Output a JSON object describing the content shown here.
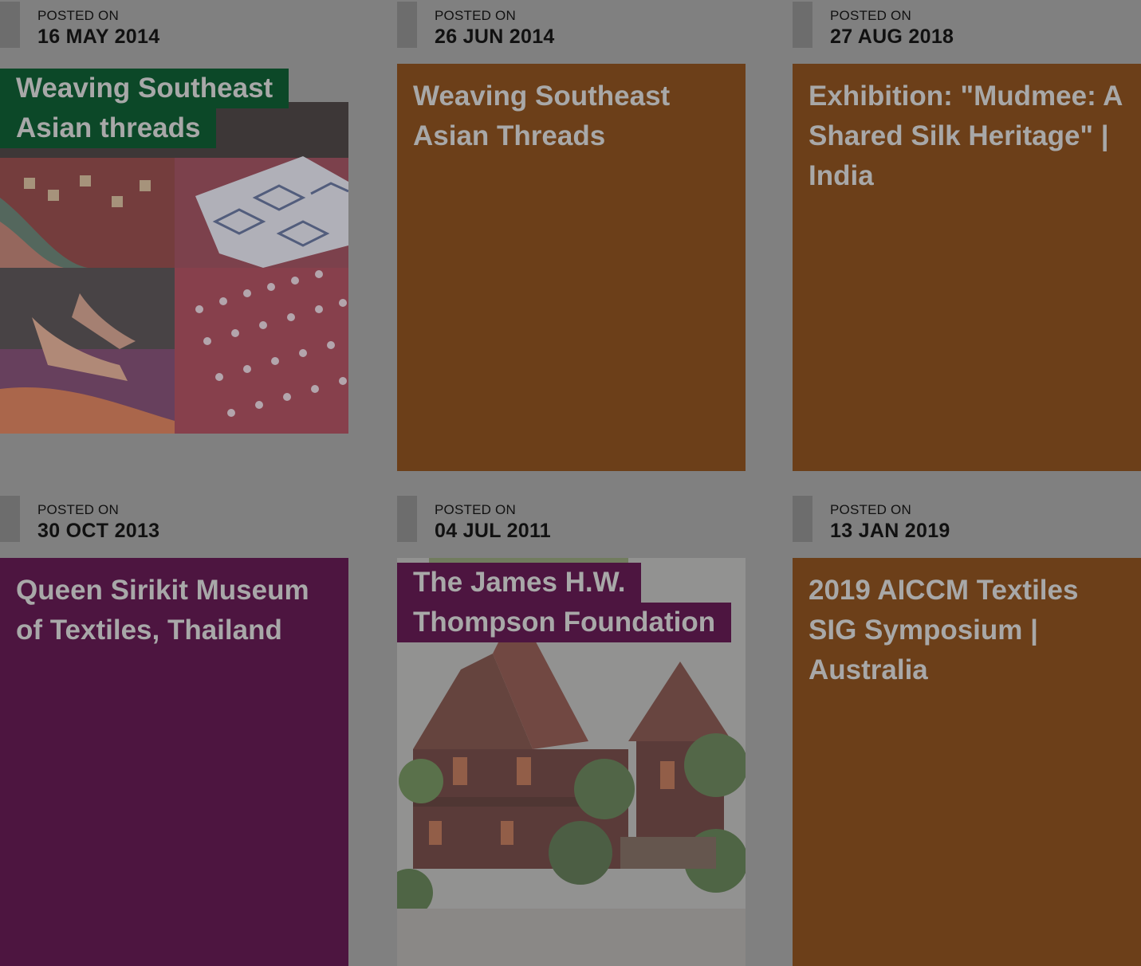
{
  "colors": {
    "page_overlay": "#808080",
    "brown_tile": "#6c3f19",
    "purple_tile": "#4d1540",
    "green_label": "#0c4828",
    "title_text": "#a8a8a8"
  },
  "posts": [
    {
      "posted_on_label": "POSTED ON",
      "date": "16 MAY 2014",
      "title_lines": [
        "Weaving Southeast",
        "Asian threads"
      ],
      "style": "photo-label",
      "label_color": "green",
      "image": "woven-textiles-collage"
    },
    {
      "posted_on_label": "POSTED ON",
      "date": "26 JUN 2014",
      "title": "Weaving Southeast Asian Threads",
      "style": "color-tile",
      "tile_color": "brown"
    },
    {
      "posted_on_label": "POSTED ON",
      "date": "27 AUG 2018",
      "title": "Exhibition: \"Mudmee: A Shared Silk Heritage\" | India",
      "style": "color-tile",
      "tile_color": "brown"
    },
    {
      "posted_on_label": "POSTED ON",
      "date": "30 OCT 2013",
      "title": "Queen Sirikit Museum of Textiles, Thailand",
      "style": "color-tile",
      "tile_color": "purple"
    },
    {
      "posted_on_label": "POSTED ON",
      "date": "04 JUL 2011",
      "title_lines": [
        "The James H.W.",
        "Thompson Foundation"
      ],
      "style": "photo-label",
      "label_color": "purple",
      "image": "thai-teak-house"
    },
    {
      "posted_on_label": "POSTED ON",
      "date": "13 JAN 2019",
      "title": "2019 AICCM Textiles SIG Symposium | Australia",
      "style": "color-tile",
      "tile_color": "brown"
    }
  ]
}
